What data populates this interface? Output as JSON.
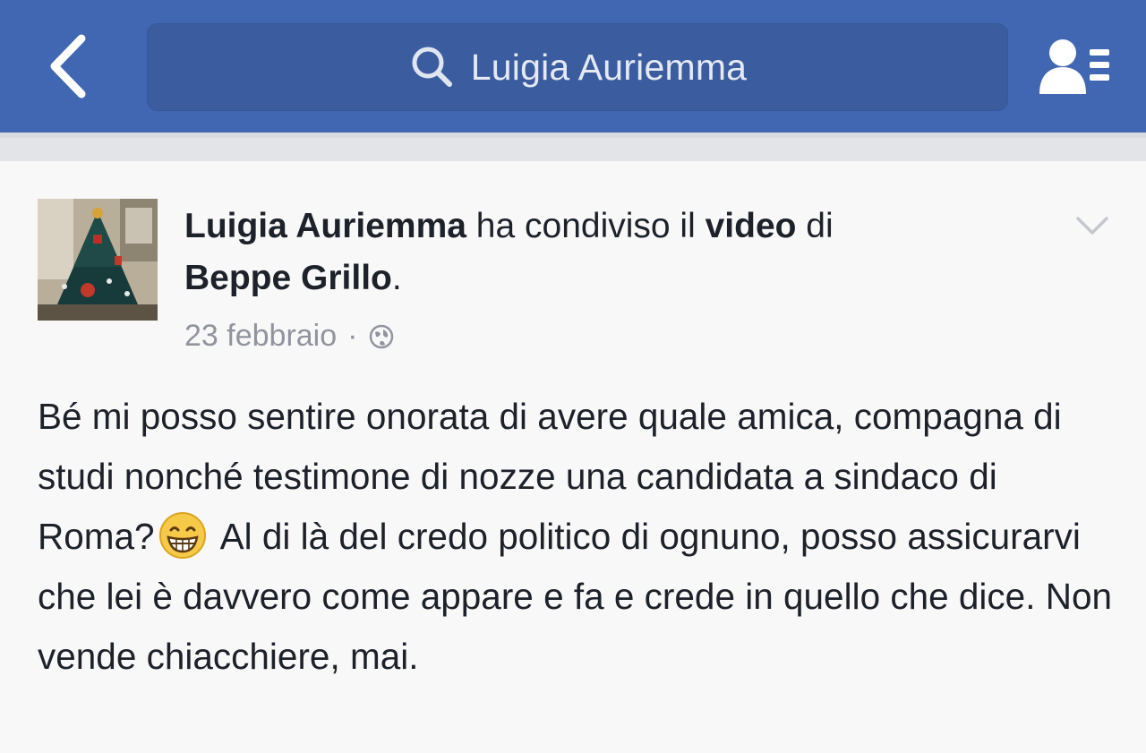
{
  "header": {
    "search_query": "Luigia Auriemma",
    "back_icon": "chevron-left-icon",
    "search_icon": "search-icon",
    "friends_icon": "friend-list-icon",
    "bar_color": "#4267b2"
  },
  "post": {
    "author": "Luigia Auriemma",
    "action_text": " ha condiviso il ",
    "object": "video",
    "preposition": " di",
    "target": "Beppe Grillo",
    "target_suffix": ".",
    "date": "23 febbraio",
    "separator": "·",
    "privacy_icon": "globe-icon",
    "menu_icon": "chevron-down-icon",
    "body_part1": "Bé mi posso sentire onorata di avere quale amica, compagna di studi nonché testimone di nozze una candidata a sindaco di Roma?",
    "emoji": "grinning-face-emoji",
    "body_part2": " Al di là del credo politico di ognuno, posso assicurarvi che lei è davvero come appare  e fa e crede in quello che dice. Non vende chiacchiere, mai."
  }
}
